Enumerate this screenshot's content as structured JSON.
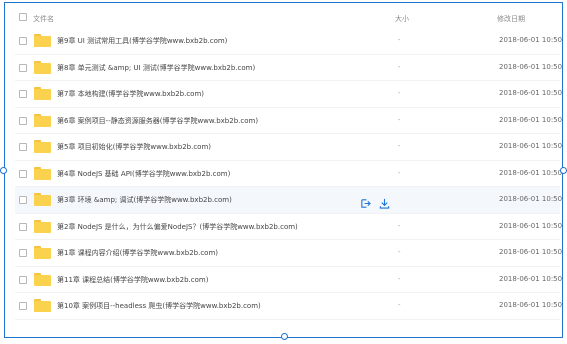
{
  "header": {
    "name_label": "文件名",
    "size_label": "大小",
    "date_label": "修改日期"
  },
  "colors": {
    "accent": "#1f74d4",
    "folder": "#fbd24e",
    "hover_row": "#f4f8fd"
  },
  "rows": [
    {
      "name": "第9章 UI 测试常用工具(博学谷学院www.bxb2b.com)",
      "size": "-",
      "date": "2018-06-01 10:50"
    },
    {
      "name": "第8章 单元测试 &amp; UI 测试(博学谷学院www.bxb2b.com)",
      "size": "-",
      "date": "2018-06-01 10:50"
    },
    {
      "name": "第7章 本地构建(博学谷学院www.bxb2b.com)",
      "size": "-",
      "date": "2018-06-01 10:50"
    },
    {
      "name": "第6章 案例项目--静态资源服务器(博学谷学院www.bxb2b.com)",
      "size": "-",
      "date": "2018-06-01 10:50"
    },
    {
      "name": "第5章 项目初始化(博学谷学院www.bxb2b.com)",
      "size": "-",
      "date": "2018-06-01 10:50"
    },
    {
      "name": "第4章 NodeJS 基础 API(博学谷学院www.bxb2b.com)",
      "size": "-",
      "date": "2018-06-01 10:50"
    },
    {
      "name": "第3章 环境 &amp; 调试(博学谷学院www.bxb2b.com)",
      "size": "",
      "date": "2018-06-01 10:50",
      "hover": true
    },
    {
      "name": "第2章 NodeJS 是什么，为什么偏爱NodeJS？(博学谷学院www.bxb2b.com)",
      "size": "-",
      "date": "2018-06-01 10:50"
    },
    {
      "name": "第1章 课程内容介绍(博学谷学院www.bxb2b.com)",
      "size": "-",
      "date": "2018-06-01 10:50"
    },
    {
      "name": "第11章 课程总结(博学谷学院www.bxb2b.com)",
      "size": "-",
      "date": "2018-06-01 10:50"
    },
    {
      "name": "第10章 案例项目--headless 爬虫(博学谷学院www.bxb2b.com)",
      "size": "-",
      "date": "2018-06-01 10:50"
    }
  ],
  "row_actions": {
    "share_icon": "share-icon",
    "download_icon": "download-icon"
  }
}
